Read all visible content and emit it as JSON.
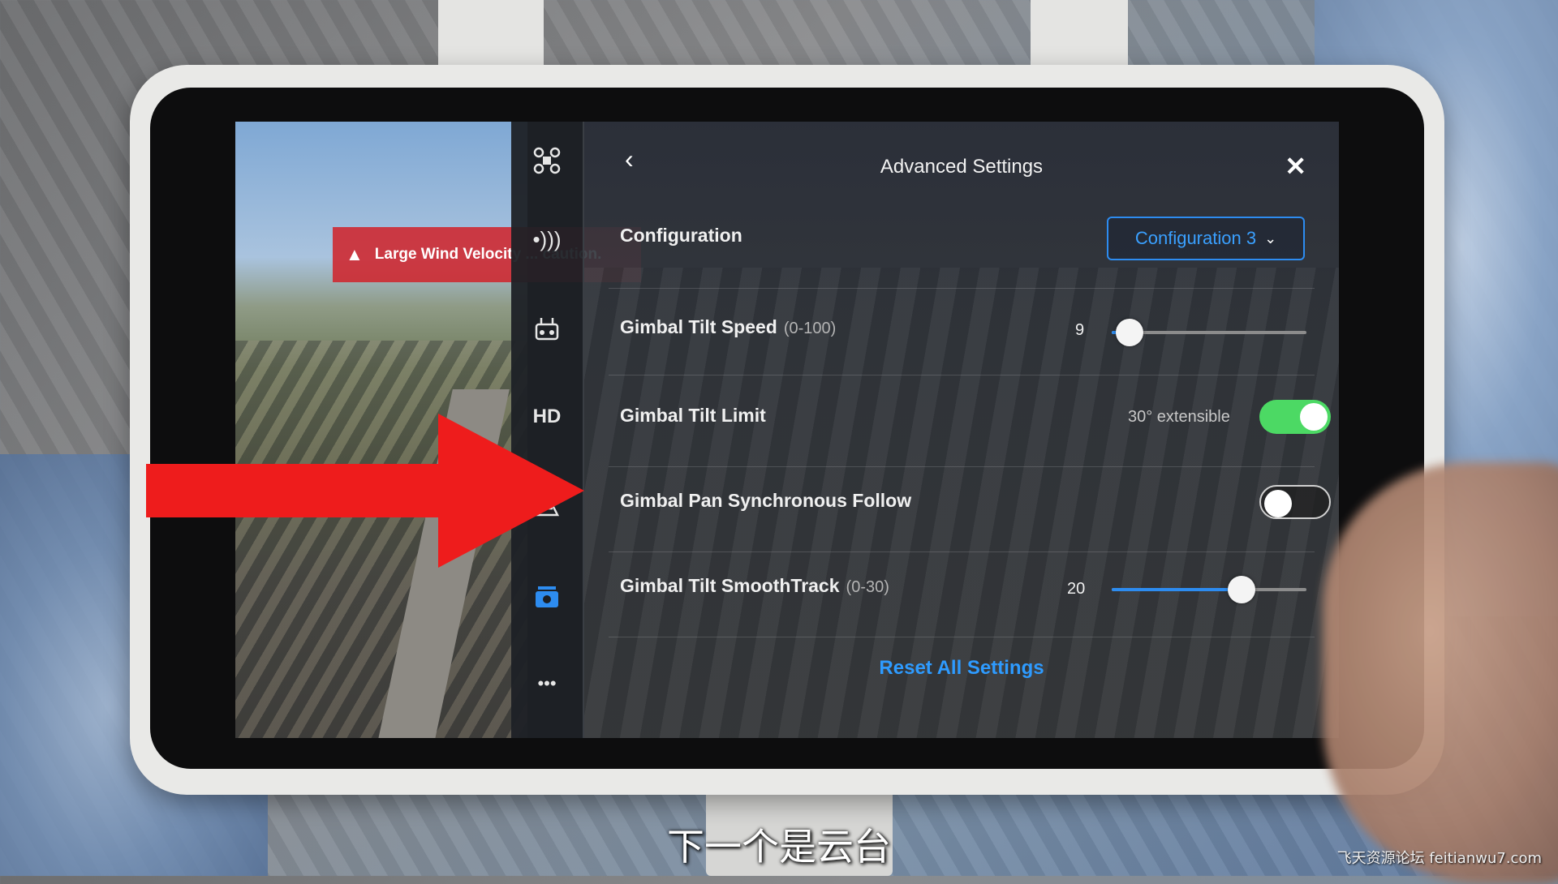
{
  "warning": {
    "icon": "warning-triangle-icon",
    "text": "Large Wind Velocity ... caution."
  },
  "nav": {
    "icons": [
      "aircraft-icon",
      "signal-icon",
      "remote-controller-icon",
      "hd-icon",
      "flight-assist-icon",
      "camera-icon",
      "more-icon"
    ],
    "hd_label": "HD",
    "more_label": "•••"
  },
  "panel": {
    "back_glyph": "‹",
    "title": "Advanced Settings",
    "close_glyph": "✕",
    "configuration": {
      "label": "Configuration",
      "selected": "Configuration 3",
      "chevron": "⌄"
    },
    "tilt_speed": {
      "label": "Gimbal Tilt Speed",
      "range": "(0-100)",
      "value": "9",
      "fraction": 0.09
    },
    "tilt_limit": {
      "label": "Gimbal Tilt Limit",
      "note": "30° extensible",
      "enabled": true
    },
    "pan_follow": {
      "label": "Gimbal Pan Synchronous Follow",
      "enabled": false
    },
    "smoothtrack": {
      "label": "Gimbal Tilt SmoothTrack",
      "range": "(0-30)",
      "value": "20",
      "fraction": 0.667
    },
    "reset_label": "Reset All Settings"
  },
  "colors": {
    "accent": "#2d8cf0",
    "toggle_on": "#4cd964",
    "warning": "#cf262d",
    "arrow": "#ee1c1c"
  },
  "subtitle": "下一个是云台",
  "watermark": "飞天资源论坛 feitianwu7.com"
}
